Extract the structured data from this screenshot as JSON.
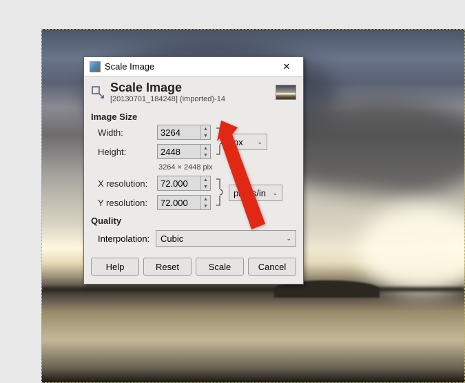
{
  "window": {
    "title": "Scale Image",
    "close_glyph": "✕"
  },
  "header": {
    "title": "Scale Image",
    "subtitle": "[20130701_184248] (imported)-14"
  },
  "image_size": {
    "section_label": "Image Size",
    "width_label": "Width:",
    "height_label": "Height:",
    "width_value": "3264",
    "height_value": "2448",
    "dims_readout": "3264 × 2448 pix",
    "unit_selected": "px"
  },
  "resolution": {
    "xres_label": "X resolution:",
    "yres_label": "Y resolution:",
    "xres_value": "72.000",
    "yres_value": "72.000",
    "unit_selected": "pixels/in"
  },
  "quality": {
    "section_label": "Quality",
    "interp_label": "Interpolation:",
    "interp_selected": "Cubic"
  },
  "buttons": {
    "help": "Help",
    "reset": "Reset",
    "scale": "Scale",
    "cancel": "Cancel"
  },
  "icons": {
    "chevron": "⌄",
    "up": "▲",
    "down": "▼"
  },
  "annotation": {
    "color": "#e02814"
  }
}
